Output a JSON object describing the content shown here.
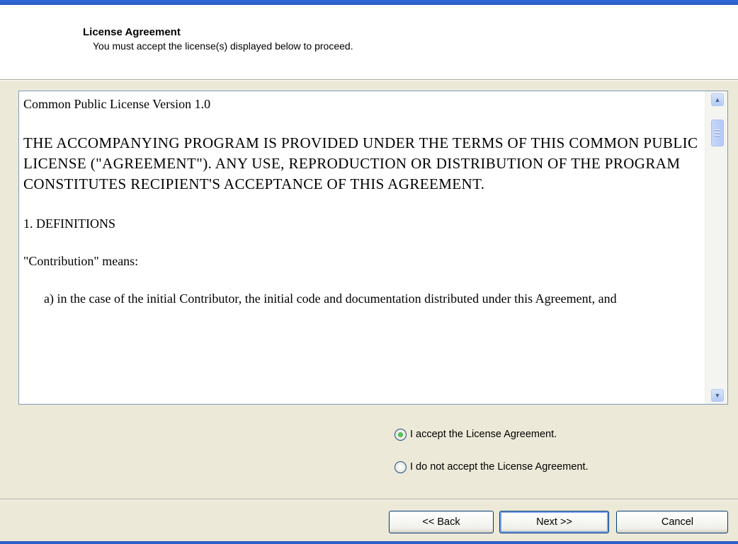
{
  "header": {
    "title": "License Agreement",
    "subtitle": "You must accept the license(s) displayed below to proceed."
  },
  "license": {
    "paragraphs": [
      "Common Public License Version 1.0",
      "THE ACCOMPANYING PROGRAM IS PROVIDED UNDER THE TERMS OF THIS COMMON PUBLIC LICENSE (\"AGREEMENT\"). ANY USE, REPRODUCTION OR DISTRIBUTION OF THE PROGRAM CONSTITUTES RECIPIENT'S ACCEPTANCE OF THIS AGREEMENT.",
      "1. DEFINITIONS",
      "\"Contribution\" means:",
      "a) in the case of the initial Contributor, the initial code and documentation distributed under this Agreement, and"
    ]
  },
  "options": {
    "accept_label": "I accept the License Agreement.",
    "decline_label": "I do not accept the License Agreement.",
    "selected": "accept"
  },
  "buttons": {
    "back_label": "<< Back",
    "next_label": "Next >>",
    "cancel_label": "Cancel"
  },
  "colors": {
    "title_bar": "#2b5dc8",
    "dialog_bg": "#ece9d8",
    "radio_checked": "#21a121"
  },
  "icons": {
    "scroll_up": "chevron-up-icon",
    "scroll_down": "chevron-down-icon"
  }
}
